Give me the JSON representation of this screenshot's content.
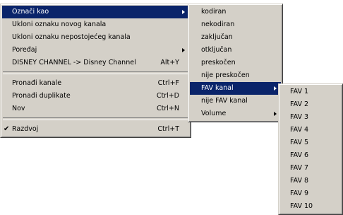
{
  "main_menu": {
    "items": [
      {
        "label": "Označi kao"
      },
      {
        "label": "Ukloni oznaku novog kanala"
      },
      {
        "label": "Ukloni oznaku nepostojećeg kanala"
      },
      {
        "label": "Poređaj"
      },
      {
        "label": "DISNEY CHANNEL -> Disney Channel",
        "shortcut": "Alt+Y"
      },
      {
        "label": "Pronađi kanale",
        "shortcut": "Ctrl+F"
      },
      {
        "label": "Pronađi duplikate",
        "shortcut": "Ctrl+D"
      },
      {
        "label": "Nov",
        "shortcut": "Ctrl+N"
      },
      {
        "label": "Razdvoj",
        "shortcut": "Ctrl+T",
        "check": "✔"
      }
    ]
  },
  "mark_as_menu": {
    "items": [
      {
        "label": "kodiran"
      },
      {
        "label": "nekodiran"
      },
      {
        "label": "zaključan"
      },
      {
        "label": "otključan"
      },
      {
        "label": "preskočen"
      },
      {
        "label": "nije preskočen"
      },
      {
        "label": "FAV kanal"
      },
      {
        "label": "nije FAV kanal"
      },
      {
        "label": "Volume"
      }
    ]
  },
  "fav_menu": {
    "items": [
      {
        "label": "FAV 1"
      },
      {
        "label": "FAV 2"
      },
      {
        "label": "FAV 3"
      },
      {
        "label": "FAV 4"
      },
      {
        "label": "FAV 5"
      },
      {
        "label": "FAV 6"
      },
      {
        "label": "FAV 7"
      },
      {
        "label": "FAV 8"
      },
      {
        "label": "FAV 9"
      },
      {
        "label": "FAV 10"
      }
    ]
  },
  "colors": {
    "menu_background": "#d4d0c8",
    "highlight": "#0a246a",
    "highlight_text": "#ffffff"
  }
}
